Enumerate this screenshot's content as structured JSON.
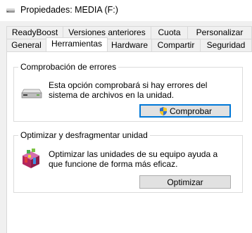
{
  "window": {
    "title": "Propiedades: MEDIA (F:)",
    "title_icon": "drive-icon"
  },
  "tabs": {
    "row1": [
      {
        "label": "ReadyBoost"
      },
      {
        "label": "Versiones anteriores"
      },
      {
        "label": "Cuota"
      },
      {
        "label": "Personalizar"
      }
    ],
    "row2": [
      {
        "label": "General"
      },
      {
        "label": "Herramientas",
        "active": true
      },
      {
        "label": "Hardware"
      },
      {
        "label": "Compartir"
      },
      {
        "label": "Seguridad"
      }
    ]
  },
  "error_check": {
    "legend": "Comprobación de errores",
    "description": "Esta opción comprobará si hay errores del sistema de archivos en la unidad.",
    "icon": "hard-drive-icon",
    "button_label": "Comprobar",
    "button_icon": "uac-shield-icon"
  },
  "optimize": {
    "legend": "Optimizar y desfragmentar unidad",
    "description": "Optimizar las unidades de su equipo ayuda a que funcione de forma más eficaz.",
    "icon": "defrag-icon",
    "button_label": "Optimizar"
  },
  "colors": {
    "window_bg": "#f0f0f0",
    "panel_bg": "#ffffff",
    "button_bg": "#e1e1e1",
    "focus_border": "#0078d7"
  }
}
